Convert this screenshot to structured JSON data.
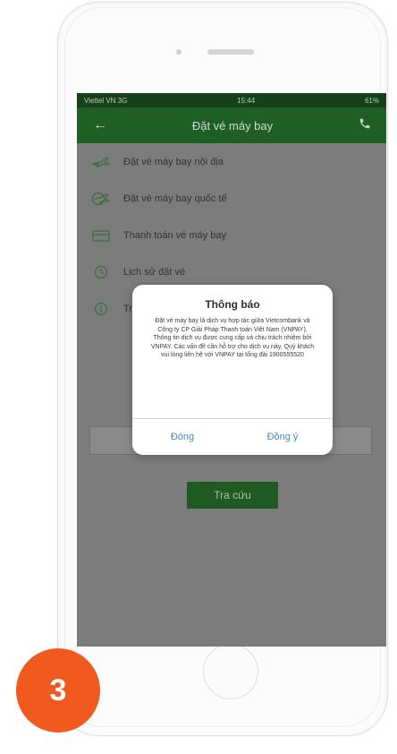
{
  "status_bar": {
    "carrier": "Viettel VN 3G",
    "time": "15:44",
    "battery": "61%"
  },
  "app_bar": {
    "title": "Đặt vé máy bay",
    "back_icon": "back-arrow-icon",
    "call_icon": "phone-icon"
  },
  "menu": [
    {
      "label": "Đặt vé máy bay nội địa",
      "icon": "plane-domestic-icon"
    },
    {
      "label": "Đặt vé máy bay quốc tế",
      "icon": "plane-international-icon"
    },
    {
      "label": "Thanh toán vé máy bay",
      "icon": "ticket-icon"
    },
    {
      "label": "Lịch sử đặt vé",
      "icon": "history-icon"
    },
    {
      "label": "Tra cứu",
      "icon": "info-icon"
    }
  ],
  "search_button": {
    "label": "Tra cứu"
  },
  "dialog": {
    "title": "Thông báo",
    "message": "Đặt vé máy bay là dịch vụ hợp tác giữa Vietcombank và Công ty CP Giải Pháp Thanh toán Việt Nam (VNPAY). Thông tin dịch vụ được cung cấp và chịu trách nhiệm bởi VNPAY. Các vấn đề cần hỗ trợ cho dịch vụ này, Quý khách vui lòng liên hệ với VNPAY tại tổng đài 1900555520",
    "close_label": "Đóng",
    "agree_label": "Đồng ý"
  },
  "step_badge": {
    "number": "3"
  },
  "colors": {
    "header_green": "#1f5f26",
    "dialog_button_blue": "#4a86c8",
    "badge_orange": "#f05a1e"
  }
}
